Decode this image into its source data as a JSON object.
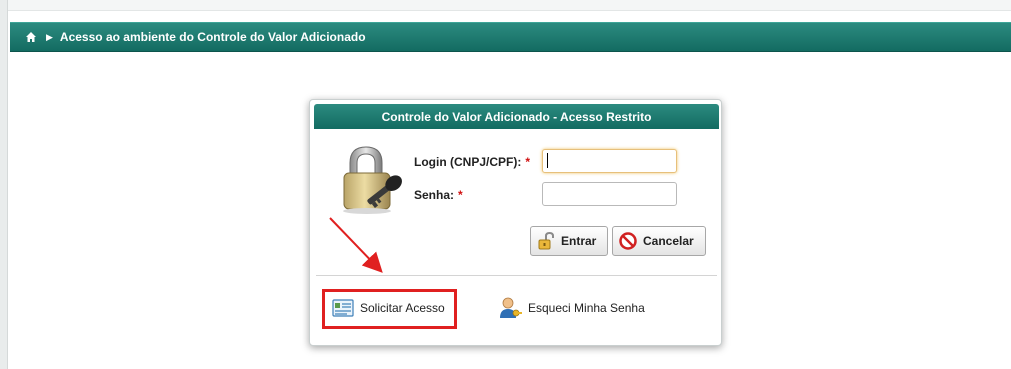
{
  "breadcrumb": {
    "home_icon": "home-icon",
    "separator_icon": "chevron-right-icon",
    "text": "Acesso ao ambiente do Controle do Valor Adicionado"
  },
  "dialog": {
    "title": "Controle do Valor Adicionado - Acesso Restrito",
    "icon": "lock-key-icon",
    "login": {
      "label": "Login (CNPJ/CPF):",
      "required_mark": "*",
      "value": ""
    },
    "password": {
      "label": "Senha:",
      "required_mark": "*",
      "value": ""
    },
    "buttons": {
      "enter": {
        "label": "Entrar",
        "icon": "unlock-icon"
      },
      "cancel": {
        "label": "Cancelar",
        "icon": "cancel-icon"
      }
    },
    "links": {
      "request_access": {
        "label": "Solicitar Acesso",
        "icon": "form-document-icon"
      },
      "forgot_password": {
        "label": "Esqueci Minha Senha",
        "icon": "user-key-icon"
      }
    }
  },
  "colors": {
    "header_teal": "#1f7a70",
    "required_red": "#d01010",
    "annotation_red": "#e02020"
  }
}
